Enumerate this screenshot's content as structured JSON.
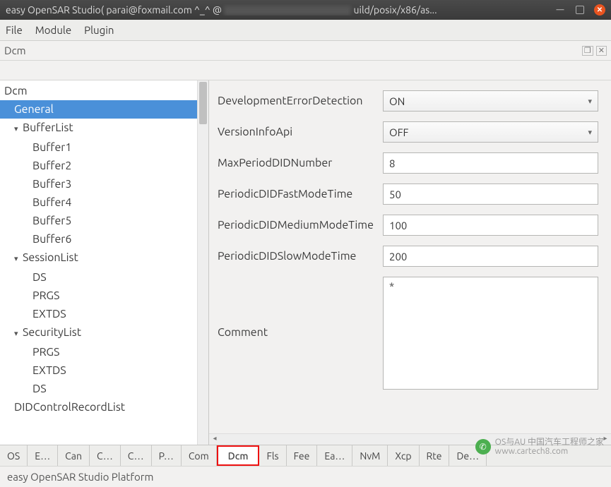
{
  "window": {
    "title_prefix": "easy OpenSAR Studio( parai@foxmail.com ^_^ @",
    "title_suffix": "uild/posix/x86/as..."
  },
  "menu": {
    "file": "File",
    "module": "Module",
    "plugin": "Plugin"
  },
  "dock": {
    "title": "Dcm"
  },
  "tree": {
    "root": "Dcm",
    "items": [
      {
        "label": "General",
        "level": 1,
        "selected": true
      },
      {
        "label": "BufferList",
        "level": 1,
        "expandable": true
      },
      {
        "label": "Buffer1",
        "level": 2
      },
      {
        "label": "Buffer2",
        "level": 2
      },
      {
        "label": "Buffer3",
        "level": 2
      },
      {
        "label": "Buffer4",
        "level": 2
      },
      {
        "label": "Buffer5",
        "level": 2
      },
      {
        "label": "Buffer6",
        "level": 2
      },
      {
        "label": "SessionList",
        "level": 1,
        "expandable": true
      },
      {
        "label": "DS",
        "level": 2
      },
      {
        "label": "PRGS",
        "level": 2
      },
      {
        "label": "EXTDS",
        "level": 2
      },
      {
        "label": "SecurityList",
        "level": 1,
        "expandable": true
      },
      {
        "label": "PRGS",
        "level": 2
      },
      {
        "label": "EXTDS",
        "level": 2
      },
      {
        "label": "DS",
        "level": 2
      },
      {
        "label": "DIDControlRecordList",
        "level": 1,
        "cut": true
      }
    ]
  },
  "form": {
    "fields": [
      {
        "label": "DevelopmentErrorDetection",
        "type": "combo",
        "value": "ON"
      },
      {
        "label": "VersionInfoApi",
        "type": "combo",
        "value": "OFF"
      },
      {
        "label": "MaxPeriodDIDNumber",
        "type": "text",
        "value": "8"
      },
      {
        "label": "PeriodicDIDFastModeTime",
        "type": "text",
        "value": "50"
      },
      {
        "label": "PeriodicDIDMediumModeTime",
        "type": "text",
        "value": "100"
      },
      {
        "label": "PeriodicDIDSlowModeTime",
        "type": "text",
        "value": "200"
      }
    ],
    "comment_label": "Comment",
    "comment_value": "*"
  },
  "tabs": {
    "items": [
      "OS",
      "E…",
      "Can",
      "C…",
      "C…",
      "P…",
      "Com",
      "Dcm",
      "Fls",
      "Fee",
      "Ea…",
      "NvM",
      "Xcp",
      "Rte",
      "De…"
    ],
    "active": "Dcm"
  },
  "status": "easy OpenSAR Studio Platform",
  "watermark": {
    "line1": "OS与AU 中国汽车工程师之家",
    "line2": "www.cartech8.com"
  }
}
